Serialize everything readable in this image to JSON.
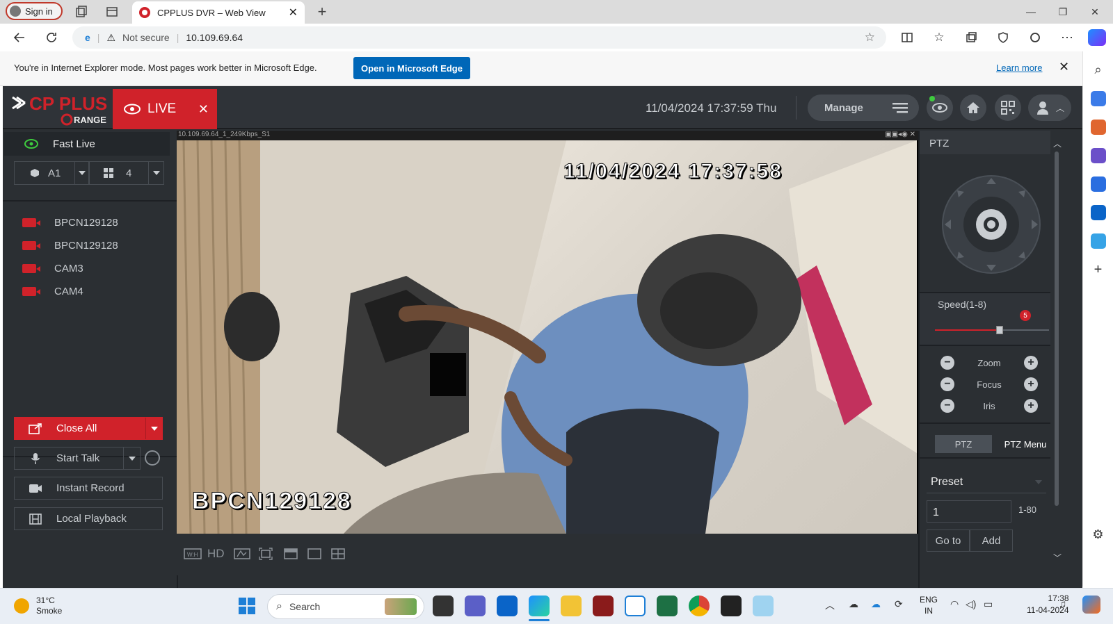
{
  "browser": {
    "signin_label": "Sign in",
    "tab_title": "CPPLUS DVR – Web View",
    "new_tab_icon": "plus-icon",
    "not_secure": "Not secure",
    "url": "10.109.69.64"
  },
  "ie_notice": {
    "text": "You're in Internet Explorer mode. Most pages work better in Microsoft Edge.",
    "open_button": "Open in Microsoft Edge",
    "learn_more": "Learn more"
  },
  "dvr": {
    "logo_text": "CP PLUS",
    "logo_sub": "RANGE",
    "live_tab": "LIVE",
    "datetime": "11/04/2024 17:37:59 Thu",
    "manage_label": "Manage",
    "brand_red": "#d0222a"
  },
  "left_panel": {
    "fast_live": "Fast Live",
    "view_select": "A1",
    "split_select": "4",
    "cameras": [
      "BPCN129128",
      "BPCN129128",
      "CAM3",
      "CAM4"
    ],
    "close_all": "Close All",
    "start_talk": "Start Talk",
    "instant_record": "Instant Record",
    "local_playback": "Local Playback"
  },
  "video": {
    "stream_title": "10.109.69.64_1_249Kbps_S1",
    "osd_datetime": "11/04/2024 17:37:58",
    "osd_name": "BPCN129128",
    "hd_label": "HD"
  },
  "ptz": {
    "header": "PTZ",
    "speed_label": "Speed(1-8)",
    "speed_value": "5",
    "speed_fraction": 0.57,
    "zoom": "Zoom",
    "focus": "Focus",
    "iris": "Iris",
    "tab_ptz": "PTZ",
    "tab_menu": "PTZ Menu",
    "preset_label": "Preset",
    "preset_value": "1",
    "preset_range": "1-80",
    "goto_label": "Go to",
    "add_label": "Add"
  },
  "taskbar": {
    "temperature": "31°C",
    "weather": "Smoke",
    "search_placeholder": "Search",
    "lang_top": "ENG",
    "lang_bottom": "IN",
    "time": "17:38",
    "date": "11-04-2024"
  }
}
